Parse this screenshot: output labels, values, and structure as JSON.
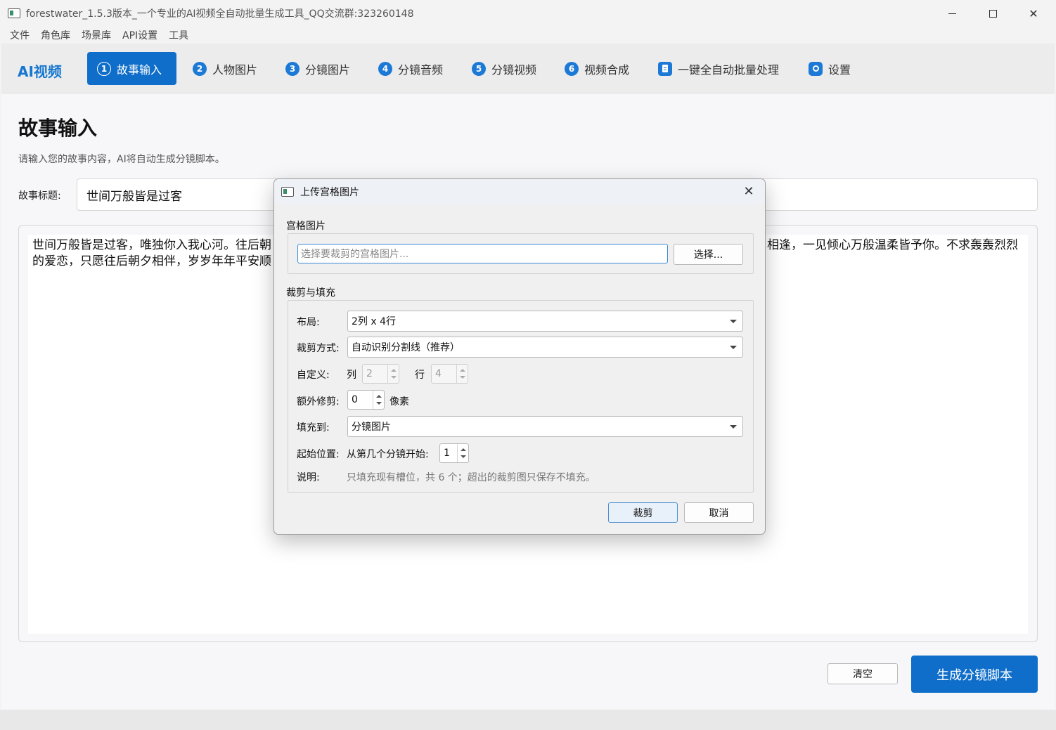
{
  "window": {
    "title": "forestwater_1.5.3版本_一个专业的AI视频全自动批量生成工具_QQ交流群:323260148",
    "close_glyph": "✕"
  },
  "menubar": [
    "文件",
    "角色库",
    "场景库",
    "API设置",
    "工具"
  ],
  "nav": {
    "brand": "AI视频",
    "tabs": [
      {
        "num": "1",
        "label": "故事输入"
      },
      {
        "num": "2",
        "label": "人物图片"
      },
      {
        "num": "3",
        "label": "分镜图片"
      },
      {
        "num": "4",
        "label": "分镜音频"
      },
      {
        "num": "5",
        "label": "分镜视频"
      },
      {
        "num": "6",
        "label": "视频合成"
      },
      {
        "label": "一键全自动批量处理"
      },
      {
        "label": "设置"
      }
    ],
    "active_index": 0
  },
  "page": {
    "title": "故事输入",
    "description": "请输入您的故事内容，AI将自动生成分镜脚本。",
    "story_title_label": "故事标题:",
    "story_title_value": "世间万般皆是过客",
    "story_text_line1_left": "世间万般皆是过客，唯独你入我心河。往后朝",
    "story_text_line1_right": "相逢，一见倾心万般温柔皆予你。不求轰轰烈烈",
    "story_text_line2": "的爱恋，只愿往后朝夕相伴，岁岁年年平安顺",
    "clear_button": "清空",
    "generate_button": "生成分镜脚本"
  },
  "dialog": {
    "title": "上传宫格图片",
    "close_glyph": "✕",
    "grid_group_label": "宫格图片",
    "path_placeholder": "选择要裁剪的宫格图片...",
    "choose_button": "选择...",
    "crop_group_label": "裁剪与填充",
    "layout_label": "布局:",
    "layout_value": "2列 x 4行",
    "crop_mode_label": "裁剪方式:",
    "crop_mode_value": "自动识别分割线（推荐）",
    "custom_label": "自定义:",
    "col_label": "列",
    "col_value": "2",
    "row_label": "行",
    "row_value": "4",
    "extra_trim_label": "额外修剪:",
    "extra_trim_value": "0",
    "extra_trim_unit": "像素",
    "fill_to_label": "填充到:",
    "fill_to_value": "分镜图片",
    "start_label": "起始位置:",
    "start_text": "从第几个分镜开始:",
    "start_value": "1",
    "note_label": "说明:",
    "note_text": "只填充现有槽位，共 6 个；超出的裁剪图只保存不填充。",
    "crop_button": "裁剪",
    "cancel_button": "取消"
  },
  "colors": {
    "accent": "#0f6ec9",
    "brand": "#1677d0"
  }
}
